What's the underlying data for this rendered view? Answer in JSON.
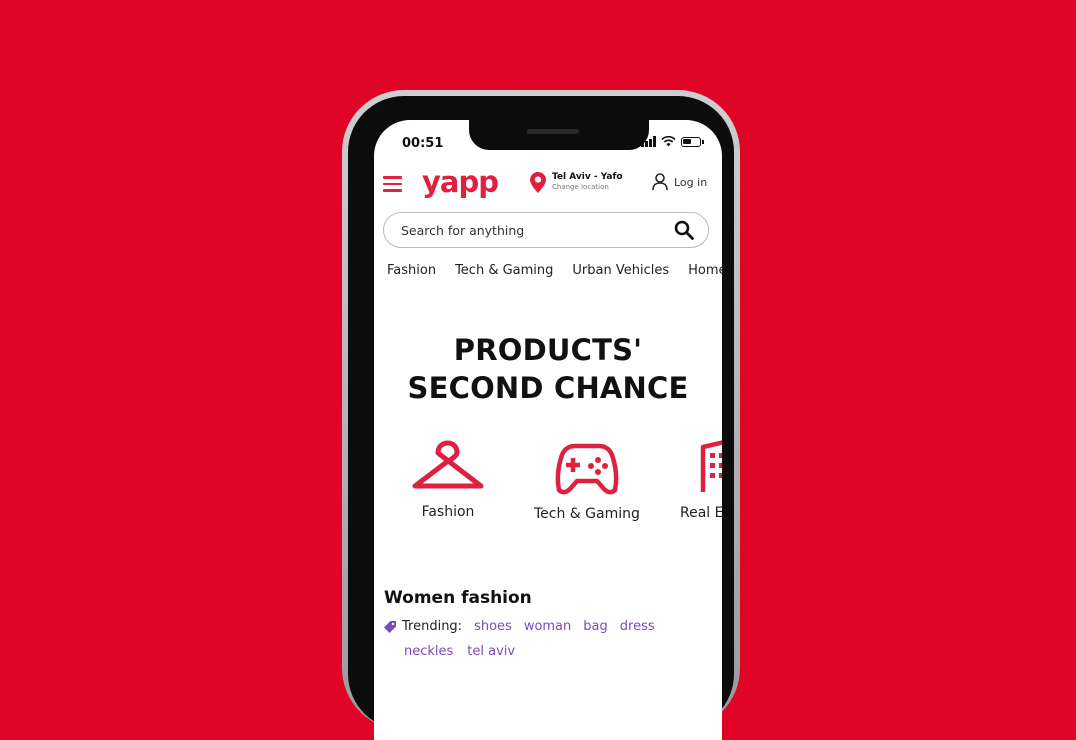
{
  "status_bar": {
    "time": "00:51"
  },
  "header": {
    "logo": "yapp",
    "location_city": "Tel Aviv - Yafo",
    "location_change": "Change location",
    "login_label": "Log in"
  },
  "search": {
    "placeholder": "Search for anything"
  },
  "categories_nav": [
    "Fashion",
    "Tech & Gaming",
    "Urban Vehicles",
    "Home"
  ],
  "hero": {
    "line1": "PRODUCTS'",
    "line2": "SECOND CHANCE"
  },
  "category_tiles": [
    {
      "label": "Fashion",
      "icon": "hanger-icon"
    },
    {
      "label": "Tech & Gaming",
      "icon": "gamepad-icon"
    },
    {
      "label": "Real Estate",
      "icon": "building-icon"
    }
  ],
  "section": {
    "title": "Women fashion",
    "trending_label": "Trending:",
    "tags": [
      "shoes",
      "woman",
      "bag",
      "dress",
      "neckles",
      "tel aviv"
    ]
  },
  "colors": {
    "background": "#e00527",
    "brand": "#e0203f",
    "tag": "#7a4bbf"
  }
}
